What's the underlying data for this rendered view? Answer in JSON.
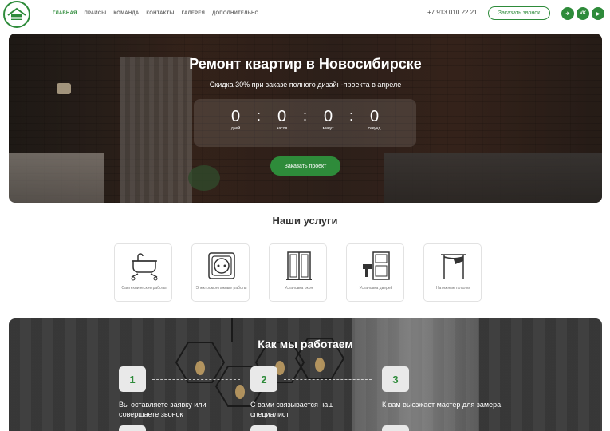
{
  "header": {
    "logo_icon": "house-logo-icon",
    "nav": [
      "ГЛАВНАЯ",
      "ПРАЙСЫ",
      "КОМАНДА",
      "КОНТАКТЫ",
      "ГАЛЕРЕЯ",
      "ДОПОЛНИТЕЛЬНО"
    ],
    "phone": "+7 913 010 22 21",
    "callback_label": "Заказать звонок",
    "socials": [
      {
        "name": "telegram-icon",
        "glyph": "✈"
      },
      {
        "name": "vk-icon",
        "glyph": "VK"
      },
      {
        "name": "youtube-icon",
        "glyph": "▶"
      }
    ]
  },
  "hero": {
    "title": "Ремонт квартир в Новосибирске",
    "subtitle": "Скидка 30% при заказе полного дизайн-проекта в апреле",
    "countdown": [
      {
        "value": "0",
        "label": "дней"
      },
      {
        "value": "0",
        "label": "часов"
      },
      {
        "value": "0",
        "label": "минут"
      },
      {
        "value": "0",
        "label": "секунд"
      }
    ],
    "order_label": "Заказать проект"
  },
  "services": {
    "title": "Наши услуги",
    "items": [
      {
        "label": "Сантехнические работы",
        "icon": "bathtub-icon"
      },
      {
        "label": "Электромонтажные работы",
        "icon": "socket-icon"
      },
      {
        "label": "Установка окон",
        "icon": "window-icon"
      },
      {
        "label": "Установка дверей",
        "icon": "door-icon"
      },
      {
        "label": "Натяжные потолки",
        "icon": "ceiling-icon"
      }
    ]
  },
  "how": {
    "title": "Как мы работаем",
    "steps": [
      {
        "num": "1",
        "text": "Вы оставляете заявку или совершаете звонок"
      },
      {
        "num": "2",
        "text": "С вами связывается наш специалист"
      },
      {
        "num": "3",
        "text": "К вам выезжает мастер для замера"
      }
    ]
  },
  "colors": {
    "accent": "#2e8b3a"
  }
}
